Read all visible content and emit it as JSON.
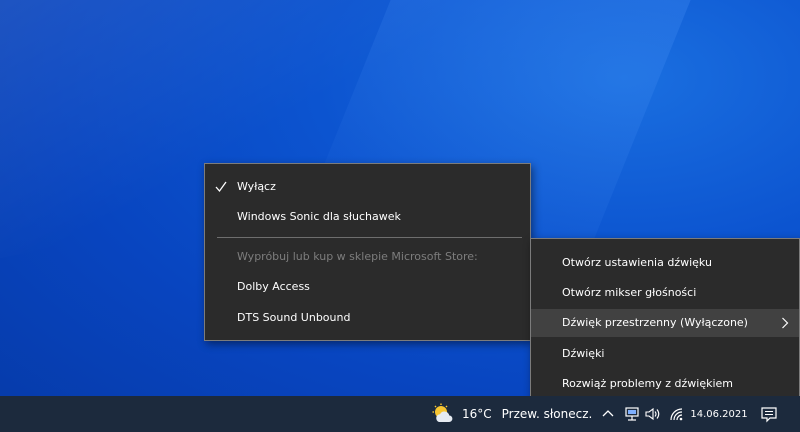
{
  "spatial_menu": {
    "items": [
      {
        "label": "Wyłącz",
        "checked": true
      },
      {
        "label": "Windows Sonic dla słuchawek",
        "checked": false
      }
    ],
    "store_hint": "Wypróbuj lub kup w sklepie Microsoft Store:",
    "store_items": [
      {
        "label": "Dolby Access"
      },
      {
        "label": "DTS Sound Unbound"
      }
    ]
  },
  "volume_menu": {
    "items": [
      {
        "label": "Otwórz ustawienia dźwięku"
      },
      {
        "label": "Otwórz mikser głośności"
      },
      {
        "label": "Dźwięk przestrzenny (Wyłączone)",
        "has_submenu": true,
        "highlighted": true
      },
      {
        "label": "Dźwięki"
      },
      {
        "label": "Rozwiąż problemy z dźwiękiem"
      }
    ]
  },
  "taskbar": {
    "weather": {
      "temperature": "16°C",
      "description": "Przew. słonecz.",
      "icon": "partly-sunny-icon"
    },
    "tray_icons": [
      "chevron-up-icon",
      "network-icon",
      "speaker-icon",
      "wifi-icon"
    ],
    "clock": {
      "date": "14.06.2021"
    },
    "notification_icon": "notification-icon"
  },
  "colors": {
    "menu_background": "#2b2b2b",
    "menu_border": "#7c7c7c",
    "highlight": "#414141",
    "taskbar": "#1c2a3d",
    "desktop": "#0c54d0"
  }
}
